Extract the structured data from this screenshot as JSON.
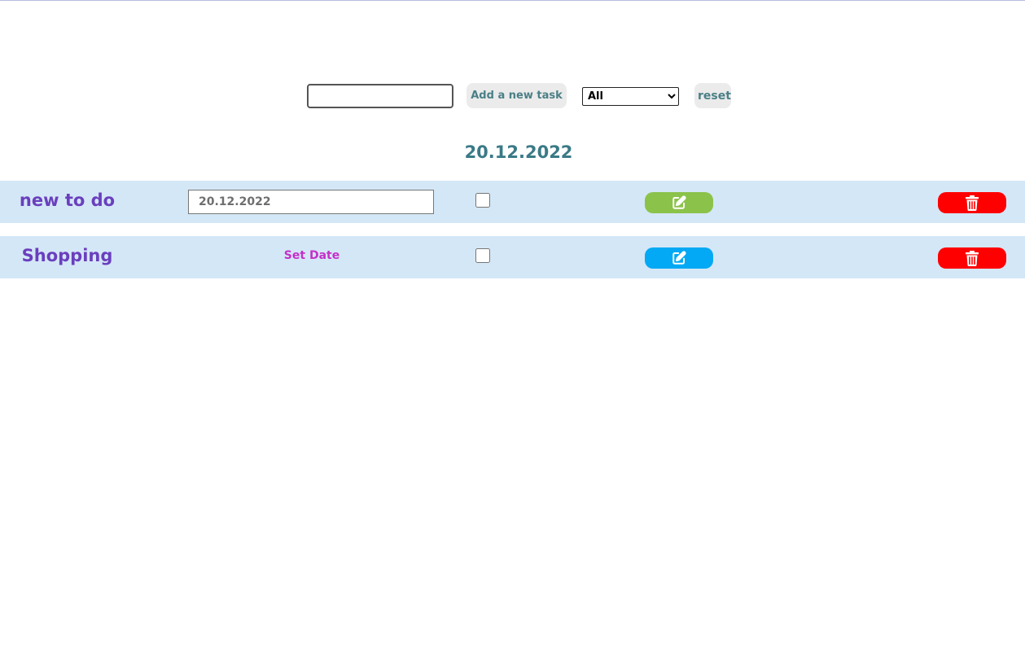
{
  "controls": {
    "task_input_value": "",
    "add_button_label": "Add a new task",
    "filter_selected": "All",
    "reset_button_label": "reset"
  },
  "current_date": "20.12.2022",
  "tasks": [
    {
      "title": "new to do",
      "date_value": "20.12.2022",
      "checked": false,
      "edit_icon": "edit-icon",
      "delete_icon": "trash-icon",
      "edit_color": "#8bc34a",
      "delete_color": "#ff0000"
    },
    {
      "title": "Shopping",
      "set_date_label": "Set Date",
      "checked": false,
      "edit_icon": "edit-icon",
      "delete_icon": "trash-icon",
      "edit_color": "#03a9f4",
      "delete_color": "#ff0000"
    }
  ],
  "colors": {
    "row_background": "#d4e7f7",
    "title_color": "#6a3fbe",
    "set_date_color": "#c530c8",
    "date_heading_color": "#3a7a86"
  }
}
